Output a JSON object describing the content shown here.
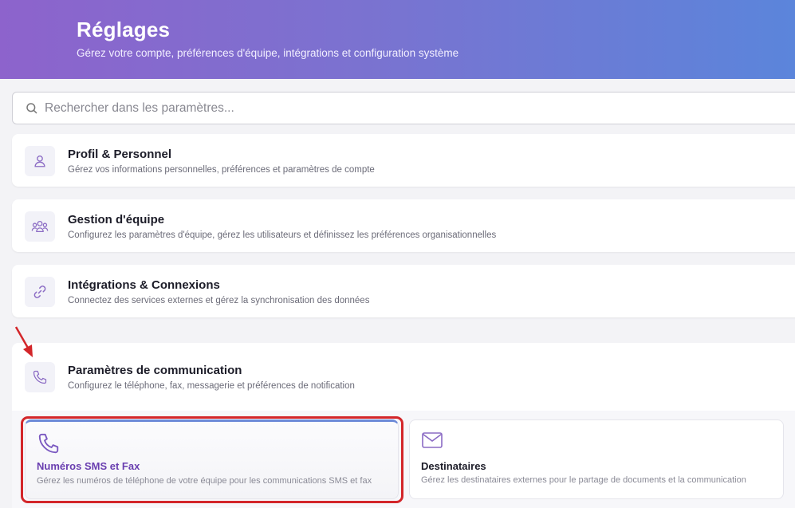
{
  "header": {
    "title": "Réglages",
    "subtitle": "Gérez votre compte, préférences d'équipe, intégrations et configuration système"
  },
  "search": {
    "placeholder": "Rechercher dans les paramètres...",
    "value": "",
    "icon": "search-icon"
  },
  "sections": [
    {
      "title": "Profil & Personnel",
      "description": "Gérez vos informations personnelles, préférences et paramètres de compte",
      "icon": "user-icon"
    },
    {
      "title": "Gestion d'équipe",
      "description": "Configurez les paramètres d'équipe, gérez les utilisateurs et définissez les préférences organisationnelles",
      "icon": "users-icon"
    },
    {
      "title": "Intégrations & Connexions",
      "description": "Connectez des services externes et gérez la synchronisation des données",
      "icon": "link-icon"
    },
    {
      "title": "Paramètres de communication",
      "description": "Configurez le téléphone, fax, messagerie et préférences de notification",
      "icon": "phone-icon",
      "expanded": true,
      "items": [
        {
          "title": "Numéros SMS et Fax",
          "description": "Gérez les numéros de téléphone de votre équipe pour les communications SMS et fax",
          "icon": "phone-icon",
          "active": true
        },
        {
          "title": "Destinataires",
          "description": "Gérez les destinataires externes pour le partage de documents et la communication",
          "icon": "mail-icon",
          "active": false
        }
      ]
    }
  ],
  "colors": {
    "accent": "#7a3fc0",
    "header_gradient_start": "#8d63cc",
    "header_gradient_end": "#5b85db",
    "highlight": "#d3262a",
    "icon_stroke": "#8b6bc4"
  }
}
